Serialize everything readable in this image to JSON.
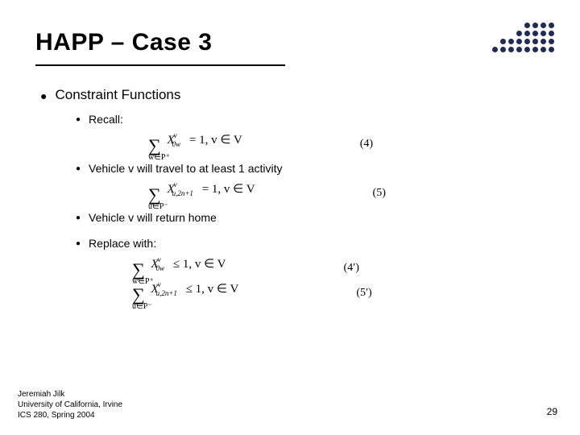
{
  "title": "HAPP – Case 3",
  "main_bullet": "Constraint Functions",
  "sub_bullets": {
    "b1": "Recall:",
    "b2": "Vehicle v will travel to at least 1 activity",
    "b3": "Vehicle v will return home",
    "b4": "Replace with:"
  },
  "equations": {
    "eq4": {
      "under": "w∈P⁺",
      "var_sup": "v",
      "var_sub": "0w",
      "rel": "= 1, v ∈ V",
      "num": "(4)"
    },
    "eq5": {
      "under": "u∈P⁻",
      "var_sup": "v",
      "var_sub": "u,2n+1",
      "rel": "= 1, v ∈ V",
      "num": "(5)"
    },
    "eq4p": {
      "under": "w∈P⁺",
      "var_sup": "v",
      "var_sub": "0w",
      "rel": "≤ 1, v ∈ V",
      "num": "(4′)"
    },
    "eq5p": {
      "under": "u∈P⁻",
      "var_sup": "v",
      "var_sub": "u,2n+1",
      "rel": "≤ 1, v ∈ V",
      "num": "(5′)"
    }
  },
  "footer": {
    "author": "Jeremiah Jilk",
    "affiliation": "University of California, Irvine",
    "course": "ICS 280, Spring 2004",
    "page": "29"
  }
}
